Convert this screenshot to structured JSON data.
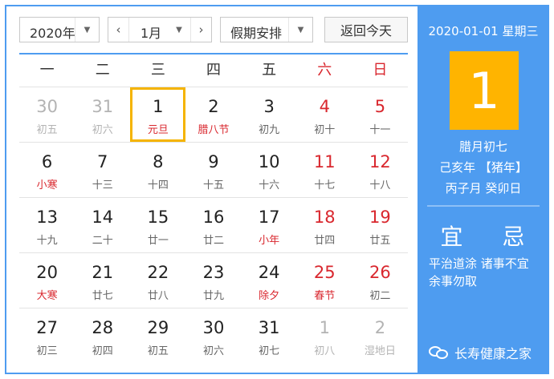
{
  "toolbar": {
    "year": "2020年",
    "month": "1月",
    "holiday": "假期安排",
    "today": "返回今天"
  },
  "weekdays": [
    "一",
    "二",
    "三",
    "四",
    "五",
    "六",
    "日"
  ],
  "weeks": [
    [
      {
        "n": "30",
        "s": "初五"
      },
      {
        "n": "31",
        "s": "初六"
      },
      {
        "n": "1",
        "s": "元旦"
      },
      {
        "n": "2",
        "s": "腊八节"
      },
      {
        "n": "3",
        "s": "初九"
      },
      {
        "n": "4",
        "s": "初十"
      },
      {
        "n": "5",
        "s": "十一"
      }
    ],
    [
      {
        "n": "6",
        "s": "小寒"
      },
      {
        "n": "7",
        "s": "十三"
      },
      {
        "n": "8",
        "s": "十四"
      },
      {
        "n": "9",
        "s": "十五"
      },
      {
        "n": "10",
        "s": "十六"
      },
      {
        "n": "11",
        "s": "十七"
      },
      {
        "n": "12",
        "s": "十八"
      }
    ],
    [
      {
        "n": "13",
        "s": "十九"
      },
      {
        "n": "14",
        "s": "二十"
      },
      {
        "n": "15",
        "s": "廿一"
      },
      {
        "n": "16",
        "s": "廿二"
      },
      {
        "n": "17",
        "s": "小年"
      },
      {
        "n": "18",
        "s": "廿四"
      },
      {
        "n": "19",
        "s": "廿五"
      }
    ],
    [
      {
        "n": "20",
        "s": "大寒"
      },
      {
        "n": "21",
        "s": "廿七"
      },
      {
        "n": "22",
        "s": "廿八"
      },
      {
        "n": "23",
        "s": "廿九"
      },
      {
        "n": "24",
        "s": "除夕"
      },
      {
        "n": "25",
        "s": "春节"
      },
      {
        "n": "26",
        "s": "初二"
      }
    ],
    [
      {
        "n": "27",
        "s": "初三"
      },
      {
        "n": "28",
        "s": "初四"
      },
      {
        "n": "29",
        "s": "初五"
      },
      {
        "n": "30",
        "s": "初六"
      },
      {
        "n": "31",
        "s": "初七"
      },
      {
        "n": "1",
        "s": "初八"
      },
      {
        "n": "2",
        "s": "湿地日"
      }
    ]
  ],
  "panel": {
    "date": "2020-01-01 星期三",
    "day": "1",
    "lunar1": "腊月初七",
    "lunar2": "己亥年 【猪年】",
    "lunar3": "丙子月 癸卯日",
    "yi": "宜",
    "ji": "忌",
    "yiji_text": "平治道涂 诸事不宜 余事勿取",
    "brand": "长寿健康之家"
  },
  "colors": {
    "accent": "#4e9cf0",
    "highlight": "#ffb400",
    "red": "#d9272e"
  }
}
